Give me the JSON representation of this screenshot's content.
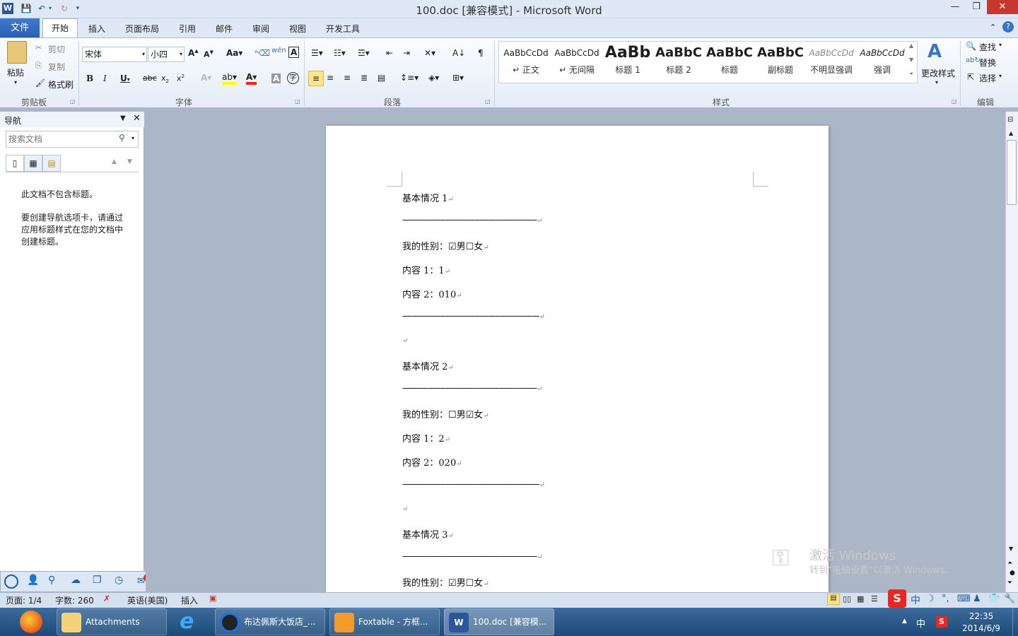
{
  "window": {
    "title": "100.doc [兼容模式] - Microsoft Word"
  },
  "tabs": {
    "file": "文件",
    "home": "开始",
    "insert": "插入",
    "layout": "页面布局",
    "references": "引用",
    "mailings": "邮件",
    "review": "审阅",
    "view": "视图",
    "developer": "开发工具"
  },
  "clipboard": {
    "paste": "粘贴",
    "cut": "剪切",
    "copy": "复制",
    "format_painter": "格式刷",
    "label": "剪贴板"
  },
  "font": {
    "name": "宋体",
    "size": "小四",
    "label": "字体"
  },
  "paragraph": {
    "label": "段落"
  },
  "styles": {
    "label": "样式",
    "items": [
      {
        "sample": "AaBbCcDd",
        "name": "↵ 正文"
      },
      {
        "sample": "AaBbCcDd",
        "name": "↵ 无间隔"
      },
      {
        "sample": "AaBb",
        "name": "标题 1"
      },
      {
        "sample": "AaBbC",
        "name": "标题 2"
      },
      {
        "sample": "AaBbC",
        "name": "标题"
      },
      {
        "sample": "AaBbC",
        "name": "副标题"
      },
      {
        "sample": "AaBbCcDd",
        "name": "不明显强调"
      },
      {
        "sample": "AaBbCcDd",
        "name": "强调"
      }
    ],
    "change": "更改样式"
  },
  "editing": {
    "find": "查找",
    "replace": "替换",
    "select": "选择",
    "label": "编辑"
  },
  "navigation": {
    "title": "导航",
    "search_placeholder": "搜索文档",
    "msg1": "此文档不包含标题。",
    "msg2": "要创建导航选项卡，请通过应用标题样式在您的文档中创建标题。"
  },
  "document": {
    "lines": [
      "基本情况 1",
      "--------------------------------------------------------",
      "我的性别：☑男☐女",
      "内容 1：1",
      "内容 2：010",
      "---------------------------------------------------------",
      "",
      "基本情况 2",
      "--------------------------------------------------------",
      "我的性别：☐男☑女",
      "内容 1：2",
      "内容 2：020",
      "---------------------------------------------------------",
      "",
      "基本情况 3",
      "--------------------------------------------------------",
      "我的性别：☑男☐女"
    ]
  },
  "watermark": {
    "line1": "激活 Windows",
    "line2": "转到\"电脑设置\"以激活 Windows。"
  },
  "status": {
    "page": "页面: 1/4",
    "words": "字数: 260",
    "language": "英语(美国)",
    "mode": "插入"
  },
  "bottom_toolbar": {
    "badge": "4"
  },
  "taskbar": {
    "items": [
      {
        "label": "Attachments"
      },
      {
        "label": "布达佩斯大饭店_..."
      },
      {
        "label": "Foxtable - 方框..."
      },
      {
        "label": "100.doc [兼容模..."
      }
    ],
    "ime": "中",
    "time": "22:35",
    "date": "2014/6/9"
  },
  "colors": {
    "file_tab": "#2b579a",
    "taskbar": "#1d4a78",
    "accent_red": "#e8281e"
  }
}
